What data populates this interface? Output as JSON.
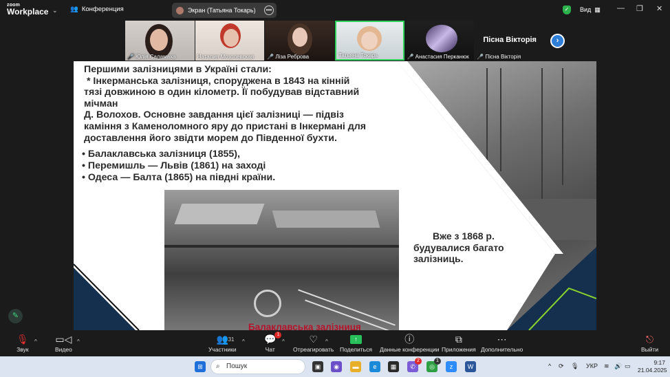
{
  "titlebar": {
    "logo_line1": "zoom",
    "logo_line2": "Workplace",
    "conference_label": "Конференция",
    "screen_share_label": "Экран (Татьяна Токарь)",
    "view_label": "Вид",
    "minimize": "—",
    "restore": "❐",
    "close": "✕"
  },
  "participants": [
    {
      "name": "Юлія Саламаха",
      "muted": true
    },
    {
      "name": "Наталия Мозолевская",
      "muted": false
    },
    {
      "name": "Ліза Реброва",
      "muted": true
    },
    {
      "name": "Татьяна Токарь",
      "muted": false,
      "active_speaker": true
    },
    {
      "name": "Анастасия Перканюк",
      "muted": true
    },
    {
      "name": "Пісна Вікторія",
      "muted": true,
      "big_name": "Пісна Вікторія"
    }
  ],
  "slide": {
    "paragraph": [
      "Першими залізницями в Україні стали:",
      " * Інкерманська залізниця, споруджена в 1843 на кінній",
      "тязі довжиною в один кілометр. Її побудував відставний",
      "мічман",
      "Д. Волохов. Основне завдання цієї залізниці — підвіз",
      "каміння з Каменоломного яру до пристані в Інкермані для",
      "доставлення його звідти морем до Південної бухти."
    ],
    "bullets": [
      "• Балаклавська залізниця (1855),",
      "• Перемишль — Львів (1861) на заході",
      "• Одеса — Балта (1865) на півдні країни."
    ],
    "side_note": [
      "Вже з 1868 р.",
      "будувалися багато",
      "залізниць."
    ],
    "caption": "Балаклавська залізниця"
  },
  "toolbar": {
    "audio": "Звук",
    "video": "Видео",
    "participants": "Участники",
    "participants_count": "31",
    "chat": "Чат",
    "chat_badge": "1",
    "react": "Отреагировать",
    "share": "Поделиться",
    "conf_info": "Данные конференции",
    "apps": "Приложения",
    "more": "Дополнительно",
    "leave": "Выйти"
  },
  "taskbar": {
    "search_placeholder": "Пошук",
    "lang": "УКР",
    "time": "9:17",
    "date": "21.04.2025",
    "badge_a": "2",
    "badge_b": "1"
  },
  "colors": {
    "accent_green": "#2ed35a",
    "slide_navy": "#15304f",
    "caption_red": "#b5122b",
    "zoom_blue": "#2f7fd8"
  }
}
